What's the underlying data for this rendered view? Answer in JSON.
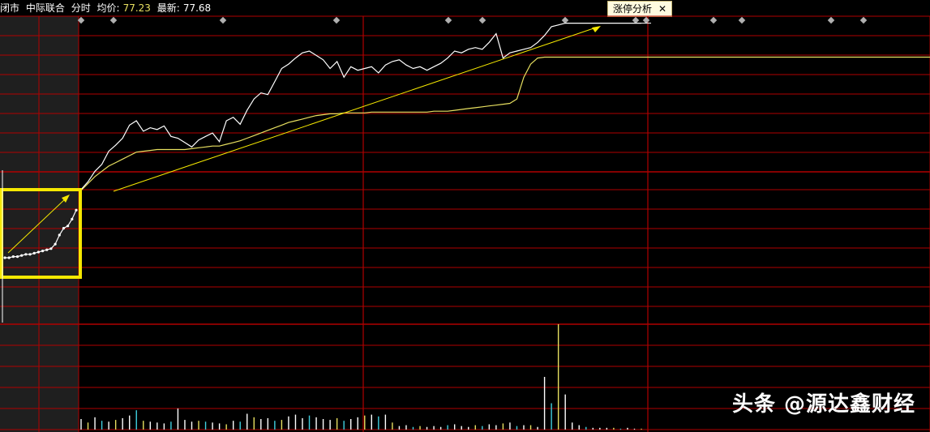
{
  "header": {
    "status": "闭市",
    "stock_name": "中际联合",
    "mode": "分时",
    "avg_label": "均价:",
    "avg_value": "77.23",
    "last_label": "最新:",
    "last_value": "77.68"
  },
  "tab": {
    "label": "涨停分析",
    "close": "✕"
  },
  "watermark": "头条 @源达鑫财经",
  "colors": {
    "grid": "#b00000",
    "price": "#ffffff",
    "avg": "#e8e060",
    "highlight": "#f5e800",
    "preopen_bg": "#1f1f1f"
  },
  "chart_data": {
    "type": "line",
    "title": "",
    "series": [
      {
        "values": [
          0.01,
          0.1,
          0.22,
          0.3,
          0.45,
          0.52,
          0.6,
          0.75,
          0.8,
          0.68,
          0.72,
          0.7,
          0.74,
          0.62,
          0.6,
          0.55,
          0.5,
          0.58,
          0.62,
          0.66,
          0.56,
          0.8,
          0.84,
          0.76,
          0.92,
          1.05,
          1.12,
          1.1,
          1.25,
          1.4,
          1.45,
          1.52,
          1.58,
          1.6,
          1.55,
          1.5,
          1.4,
          1.48,
          1.3,
          1.42,
          1.38,
          1.4,
          1.42,
          1.35,
          1.44,
          1.48,
          1.5,
          1.44,
          1.4,
          1.42,
          1.38,
          1.42,
          1.46,
          1.52,
          1.6,
          1.58,
          1.62,
          1.64,
          1.62,
          1.7,
          1.8,
          1.52,
          1.58,
          1.6,
          1.62,
          1.64,
          1.7,
          1.78,
          1.88,
          1.9,
          1.92,
          1.92,
          1.92,
          1.92,
          1.92,
          1.92,
          1.92,
          1.92,
          1.92,
          1.92,
          1.92,
          1.92
        ]
      },
      {
        "values": [
          0.0,
          0.08,
          0.16,
          0.22,
          0.28,
          0.32,
          0.36,
          0.4,
          0.44,
          0.45,
          0.46,
          0.47,
          0.47,
          0.47,
          0.47,
          0.47,
          0.48,
          0.49,
          0.5,
          0.51,
          0.51,
          0.53,
          0.55,
          0.57,
          0.6,
          0.63,
          0.66,
          0.69,
          0.72,
          0.75,
          0.78,
          0.8,
          0.82,
          0.84,
          0.86,
          0.87,
          0.88,
          0.88,
          0.89,
          0.89,
          0.89,
          0.89,
          0.9,
          0.9,
          0.9,
          0.9,
          0.9,
          0.9,
          0.9,
          0.9,
          0.9,
          0.91,
          0.91,
          0.91,
          0.92,
          0.93,
          0.94,
          0.95,
          0.96,
          0.97,
          0.98,
          0.99,
          1.0,
          1.05,
          1.3,
          1.45,
          1.52,
          1.53,
          1.53,
          1.53,
          1.53,
          1.53,
          1.53,
          1.53,
          1.53,
          1.53,
          1.53,
          1.53,
          1.53,
          1.53,
          1.53,
          1.53
        ]
      }
    ],
    "volume": [
      12,
      8,
      14,
      10,
      9,
      11,
      13,
      16,
      22,
      10,
      9,
      8,
      7,
      9,
      24,
      11,
      9,
      10,
      9,
      8,
      7,
      6,
      10,
      9,
      18,
      14,
      12,
      13,
      10,
      11,
      15,
      17,
      13,
      16,
      14,
      12,
      11,
      13,
      10,
      12,
      14,
      16,
      17,
      15,
      17,
      8,
      4,
      5,
      3,
      4,
      3,
      4,
      3,
      5,
      6,
      4,
      3,
      5,
      4,
      6,
      5,
      7,
      8,
      4,
      5,
      5,
      3,
      60,
      30,
      120,
      40,
      8,
      5,
      3,
      2,
      2,
      2,
      2,
      1,
      2,
      1,
      1
    ],
    "preopen": [
      0.0,
      0.0,
      0.01,
      0.01,
      0.02,
      0.03,
      0.03,
      0.04,
      0.05,
      0.06,
      0.07,
      0.08,
      0.12,
      0.2,
      0.26,
      0.28,
      0.34,
      0.42
    ],
    "annotations": [
      {
        "type": "trend_arrow",
        "from": [
          4,
          0.05
        ],
        "to": [
          70,
          1.85
        ]
      }
    ]
  }
}
